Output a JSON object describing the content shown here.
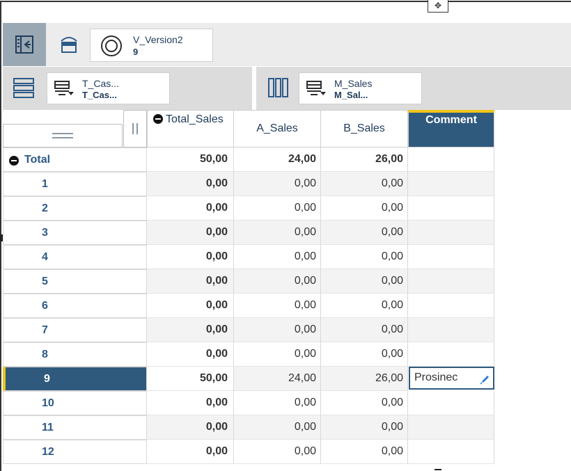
{
  "toolbar": {
    "version": {
      "name": "V_Version2",
      "value": "9"
    }
  },
  "dimensions": {
    "rows": {
      "name": "T_Cas...",
      "value": "T_Cas..."
    },
    "columns": {
      "name": "M_Sales",
      "value": "M_Sal..."
    }
  },
  "grid": {
    "columns": [
      "Total_Sales",
      "A_Sales",
      "B_Sales",
      "Comment"
    ],
    "total_row": {
      "label": "Total",
      "total_sales": "50,00",
      "a_sales": "24,00",
      "b_sales": "26,00"
    },
    "rows": [
      {
        "label": "1",
        "total_sales": "0,00",
        "a_sales": "0,00",
        "b_sales": "0,00",
        "comment": ""
      },
      {
        "label": "2",
        "total_sales": "0,00",
        "a_sales": "0,00",
        "b_sales": "0,00",
        "comment": ""
      },
      {
        "label": "3",
        "total_sales": "0,00",
        "a_sales": "0,00",
        "b_sales": "0,00",
        "comment": ""
      },
      {
        "label": "4",
        "total_sales": "0,00",
        "a_sales": "0,00",
        "b_sales": "0,00",
        "comment": ""
      },
      {
        "label": "5",
        "total_sales": "0,00",
        "a_sales": "0,00",
        "b_sales": "0,00",
        "comment": ""
      },
      {
        "label": "6",
        "total_sales": "0,00",
        "a_sales": "0,00",
        "b_sales": "0,00",
        "comment": ""
      },
      {
        "label": "7",
        "total_sales": "0,00",
        "a_sales": "0,00",
        "b_sales": "0,00",
        "comment": ""
      },
      {
        "label": "8",
        "total_sales": "0,00",
        "a_sales": "0,00",
        "b_sales": "0,00",
        "comment": ""
      },
      {
        "label": "9",
        "total_sales": "50,00",
        "a_sales": "24,00",
        "b_sales": "26,00",
        "comment": "Prosinec"
      },
      {
        "label": "10",
        "total_sales": "0,00",
        "a_sales": "0,00",
        "b_sales": "0,00",
        "comment": ""
      },
      {
        "label": "11",
        "total_sales": "0,00",
        "a_sales": "0,00",
        "b_sales": "0,00",
        "comment": ""
      },
      {
        "label": "12",
        "total_sales": "0,00",
        "a_sales": "0,00",
        "b_sales": "0,00",
        "comment": ""
      }
    ],
    "selected_row": "9"
  },
  "colors": {
    "header_blue": "#2f5a7e",
    "accent_yellow": "#f0c419",
    "text_blue": "#2c5a87"
  }
}
